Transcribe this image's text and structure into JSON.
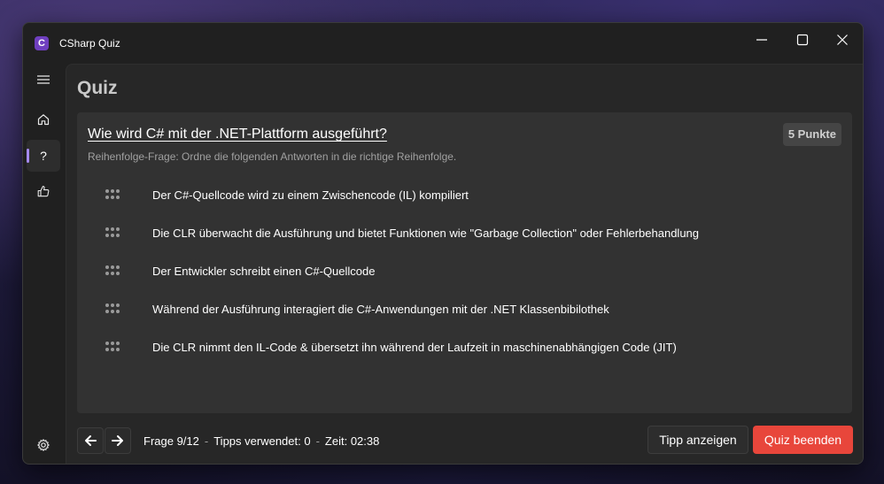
{
  "window": {
    "title": "CSharp Quiz",
    "logo_letter": "C",
    "controls": [
      "minimize-icon",
      "maximize-icon",
      "close-icon"
    ]
  },
  "nav": {
    "items": [
      {
        "icon": "hamburger-menu-icon"
      },
      {
        "icon": "home-icon"
      },
      {
        "icon": "question-icon",
        "glyph": "?",
        "selected": true
      },
      {
        "icon": "thumbs-up-icon"
      }
    ],
    "settings_icon": "gear-icon"
  },
  "page": {
    "title": "Quiz"
  },
  "question": {
    "title": "Wie wird C# mit der .NET-Plattform ausgeführt?",
    "points": "5 Punkte",
    "hint": "Reihenfolge-Frage: Ordne die folgenden Antworten in die richtige Reihenfolge.",
    "answers": [
      {
        "text": "Der C#-Quellcode wird zu einem Zwischencode (IL) kompiliert"
      },
      {
        "text": "Die CLR überwacht die Ausführung und bietet Funktionen wie \"Garbage Collection\" oder Fehlerbehandlung"
      },
      {
        "text": "Der Entwickler schreibt einen C#-Quellcode"
      },
      {
        "text": "Während der Ausführung interagiert die C#-Anwendungen mit der .NET Klassenbibilothek"
      },
      {
        "text": "Die CLR nimmt den IL-Code & übersetzt ihn während der Laufzeit in maschinenabhängigen Code (JIT)"
      }
    ]
  },
  "footer": {
    "question_counter": "Frage 9/12",
    "separator": "-",
    "tips_used": "Tipps verwendet: 0",
    "time": "Zeit: 02:38",
    "hint_button": "Tipp anzeigen",
    "end_button": "Quiz beenden"
  },
  "colors": {
    "accent": "#a58af0",
    "danger_button": "#e8463b",
    "logo": "#6f3fbf",
    "card": "#323232",
    "background": "#202020"
  }
}
